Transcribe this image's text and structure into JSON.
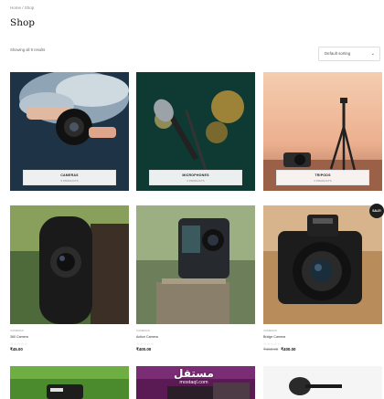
{
  "breadcrumb": "Home / Shop",
  "title": "Shop",
  "result_count": "Showing all 9 results",
  "sort": {
    "selected": "Default sorting"
  },
  "categories": [
    {
      "name": "CAMERAS",
      "count": "5 PRODUCTS"
    },
    {
      "name": "MICROPHONES",
      "count": "2 PRODUCTS"
    },
    {
      "name": "TRIPODS",
      "count": "2 PRODUCTS"
    }
  ],
  "products": [
    {
      "category": "CAMERAS",
      "name": "360 Camera",
      "stars": "☆☆☆☆☆",
      "old_price": "",
      "price": "₹45.00"
    },
    {
      "category": "CAMERAS",
      "name": "Action Camera",
      "stars": "☆☆☆☆☆",
      "old_price": "",
      "price": "₹400.00"
    },
    {
      "category": "CAMERAS",
      "name": "Bridge Camera",
      "stars": "☆☆☆☆☆",
      "old_price": "₹450.00",
      "price": "₹400.00"
    }
  ],
  "sale_badge": "SALE!",
  "watermark": {
    "arabic": "مستقل",
    "latin": "mostaql.com"
  },
  "colors": {
    "accent": "#1d1d1d",
    "background": "#ffffff"
  }
}
